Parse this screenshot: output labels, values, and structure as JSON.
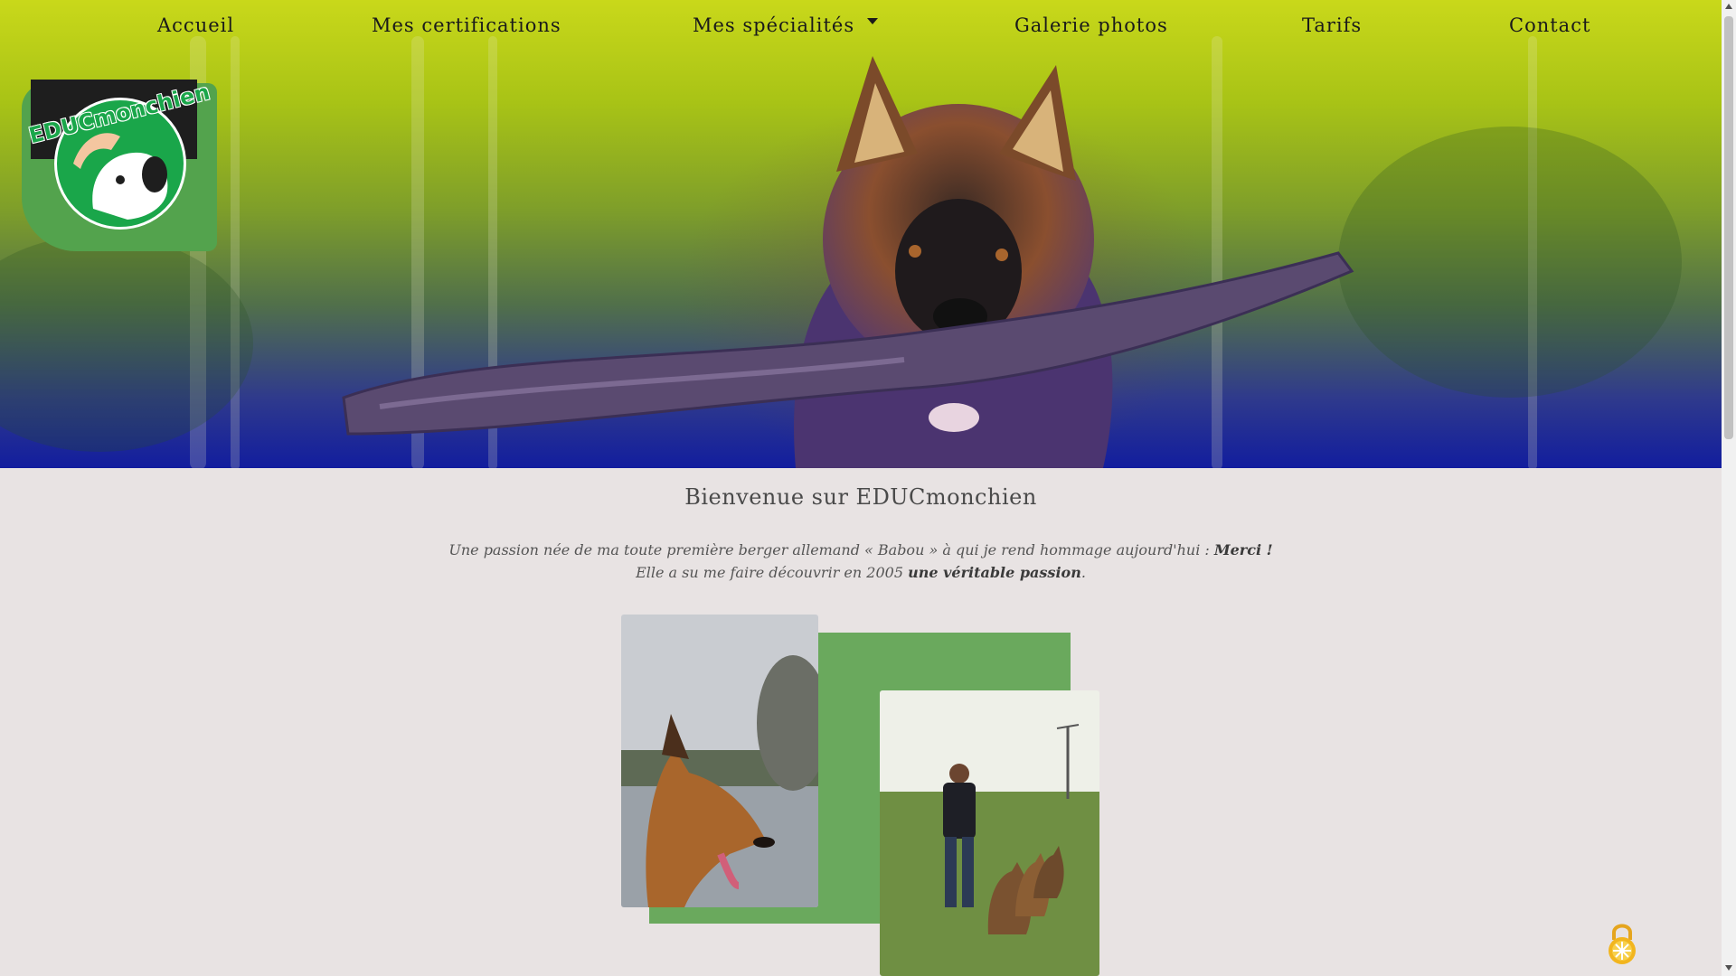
{
  "nav": {
    "items": [
      {
        "label": "Accueil"
      },
      {
        "label": "Mes certifications"
      },
      {
        "label": "Mes spécialités"
      },
      {
        "label": "Galerie photos"
      },
      {
        "label": "Tarifs"
      },
      {
        "label": "Contact"
      }
    ]
  },
  "logo": {
    "text": "EDUCmonchien"
  },
  "main": {
    "title": "Bienvenue sur EDUCmonchien",
    "intro_line1_prefix": "Une passion née de ma toute première berger allemand « Babou » à qui je rend hommage aujourd'hui : ",
    "intro_line1_bold": "Merci !",
    "intro_line2_prefix": "Elle a su me faire découvrir en 2005 ",
    "intro_line2_bold": "une véritable passion",
    "intro_line2_suffix": "."
  },
  "colors": {
    "page_bg": "#e8e3e3",
    "accent_green": "#6aa95d",
    "logo_green": "#1aa64a"
  },
  "icons": {
    "cookie_button": "lock-cookie-icon",
    "dropdown": "chevron-down-icon"
  }
}
